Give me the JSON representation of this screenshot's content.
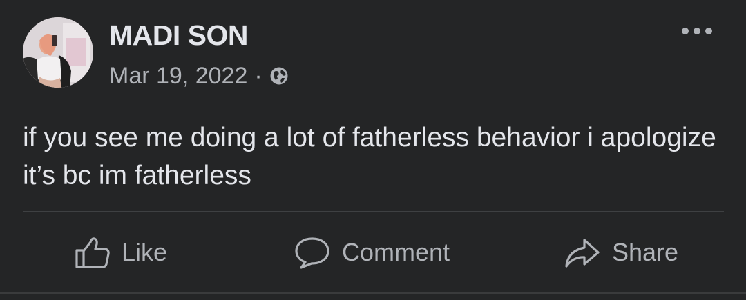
{
  "post": {
    "author": "MADI SON",
    "date": "Mar 19, 2022",
    "separator": "·",
    "audience_icon": "globe-icon",
    "more_icon": "more-options-icon",
    "text": "if you see me doing a lot of fatherless behavior i apologize it’s bc im fatherless"
  },
  "actions": {
    "like_label": "Like",
    "comment_label": "Comment",
    "share_label": "Share"
  },
  "colors": {
    "background": "#242526",
    "primary_text": "#e4e6eb",
    "secondary_text": "#b0b3b8",
    "divider": "#3e4042"
  }
}
